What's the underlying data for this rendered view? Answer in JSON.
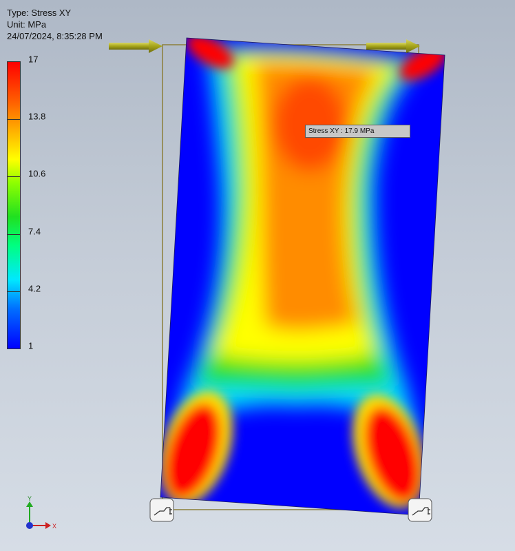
{
  "info": {
    "type_line": "Type: Stress XY",
    "unit_line": "Unit: MPa",
    "timestamp": "24/07/2024, 8:35:28 PM"
  },
  "legend": {
    "labels": [
      "17",
      "13.8",
      "10.6",
      "7.4",
      "4.2",
      "1"
    ]
  },
  "probe": {
    "label": "Stress XY : 17.9 MPa"
  },
  "triad": {
    "y_label": "Y",
    "x_label": "X"
  },
  "colors": {
    "min": "#0000ff",
    "max": "#ff0000",
    "arrow": "#a6a51a",
    "outline": "#8b7f3a"
  },
  "icons": {
    "load_arrow": "arrow-right-icon",
    "constraint": "fixed-constraint-icon",
    "triad": "coordinate-triad-icon"
  }
}
